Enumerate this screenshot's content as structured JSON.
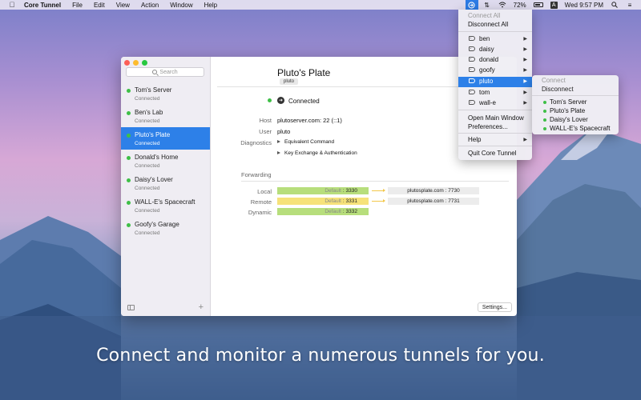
{
  "menubar": {
    "app": "Core Tunnel",
    "items": [
      "File",
      "Edit",
      "View",
      "Action",
      "Window",
      "Help"
    ],
    "battery": "72%",
    "clock": "Wed 9:57 PM"
  },
  "window": {
    "search_placeholder": "Search",
    "servers": [
      {
        "name": "Tom's Server",
        "status": "Connected"
      },
      {
        "name": "Ben's Lab",
        "status": "Connected"
      },
      {
        "name": "Pluto's Plate",
        "status": "Connected"
      },
      {
        "name": "Donald's Home",
        "status": "Connected"
      },
      {
        "name": "Daisy's Lover",
        "status": "Connected"
      },
      {
        "name": "WALL-E's Spacecraft",
        "status": "Connected"
      },
      {
        "name": "Goofy's Garage",
        "status": "Connected"
      }
    ],
    "detail": {
      "title": "Pluto's Plate",
      "subtitle": "pluto",
      "status": "Connected",
      "host_label": "Host",
      "host": "plutoserver.com: 22 (::1)",
      "user_label": "User",
      "user": "pluto",
      "diag_label": "Diagnostics",
      "diag1": "Equivalent Command",
      "diag2": "Key Exchange & Authentication",
      "forwarding_label": "Forwarding",
      "rows": [
        {
          "label": "Local",
          "def": "Default",
          "port": ": 3330",
          "remote": "plutosplate.com : 7730"
        },
        {
          "label": "Remote",
          "def": "Default",
          "port": ": 3331",
          "remote": "plutosplate.com : 7731"
        },
        {
          "label": "Dynamic",
          "def": "Default",
          "port": ": 3332",
          "remote": ""
        }
      ],
      "settings": "Settings..."
    }
  },
  "menu": {
    "connect_all": "Connect All",
    "disconnect_all": "Disconnect All",
    "tags": [
      "ben",
      "daisy",
      "donald",
      "goofy",
      "pluto",
      "tom",
      "wall-e"
    ],
    "open_main": "Open Main Window",
    "preferences": "Preferences...",
    "help": "Help",
    "quit": "Quit Core Tunnel"
  },
  "submenu": {
    "connect": "Connect",
    "disconnect": "Disconnect",
    "items": [
      "Tom's Server",
      "Pluto's Plate",
      "Daisy's Lover",
      "WALL-E's Spacecraft"
    ]
  },
  "caption": "Connect and monitor a numerous tunnels for you."
}
